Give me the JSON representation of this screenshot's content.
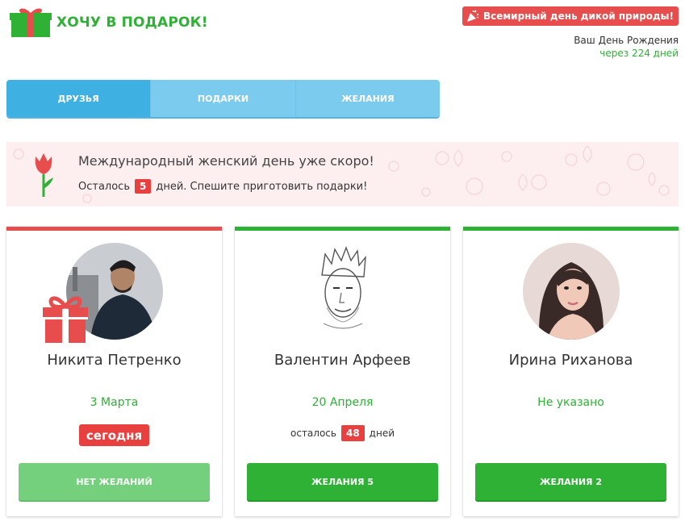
{
  "header": {
    "logo_text": "ХОЧУ В ПОДАРОК!",
    "event_badge": "Всемирный день дикой природы!",
    "birthday_label": "Ваш День Рождения",
    "birthday_countdown": "через 224 дней"
  },
  "tabs": [
    {
      "label": "ДРУЗЬЯ",
      "active": true
    },
    {
      "label": "ПОДАРКИ",
      "active": false
    },
    {
      "label": "ЖЕЛАНИЯ",
      "active": false
    }
  ],
  "banner": {
    "title": "Международный женский день уже скоро!",
    "remaining_prefix": "Осталось",
    "remaining_count": "5",
    "remaining_suffix": "дней. Спешите приготовить подарки!"
  },
  "friends": [
    {
      "name": "Никита Петренко",
      "date": "3 Марта",
      "today_label": "сегодня",
      "button": "НЕТ ЖЕЛАНИЙ",
      "accent": "#e84d4d"
    },
    {
      "name": "Валентин Арфеев",
      "date": "20 Апреля",
      "left_prefix": "осталось",
      "left_count": "48",
      "left_suffix": "дней",
      "button": "ЖЕЛАНИЯ 5",
      "accent": "#2eb135"
    },
    {
      "name": "Ирина Риханова",
      "date": "Не указано",
      "button": "ЖЕЛАНИЯ 2",
      "accent": "#2eb135"
    }
  ],
  "colors": {
    "brand_green": "#2eb135",
    "tab_active": "#3fb0e2",
    "tab_inactive": "#7bcbef",
    "alert_red": "#e8403f",
    "banner_bg": "#fdeef0"
  }
}
